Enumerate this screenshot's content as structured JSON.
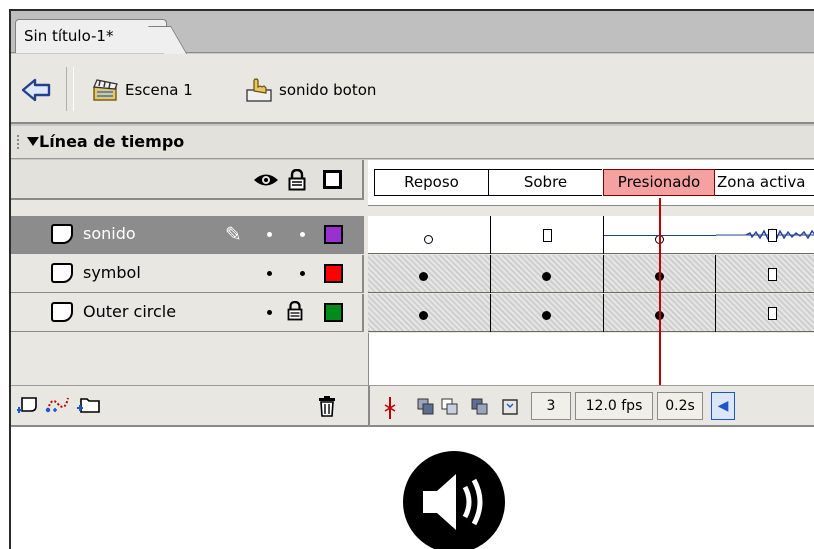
{
  "document": {
    "tab_title": "Sin título-1*"
  },
  "breadcrumb": {
    "scene_label": "Escena 1",
    "symbol_label": "sonido boton"
  },
  "timeline": {
    "panel_title": "Línea de tiempo",
    "frame_labels": [
      "Reposo",
      "Sobre",
      "Presionado",
      "Zona activa"
    ],
    "current_frame_label": "Presionado",
    "layers": [
      {
        "name": "sonido",
        "selected": true,
        "color": "#9b30d0",
        "keyframes": [
          "empty",
          "end",
          "playhead",
          "end-with-sound"
        ]
      },
      {
        "name": "symbol",
        "selected": false,
        "color": "#ff0000",
        "keyframes": [
          "filled",
          "filled",
          "filled",
          "end"
        ]
      },
      {
        "name": "Outer circle",
        "selected": false,
        "color": "#008c1a",
        "locked": true,
        "keyframes": [
          "filled",
          "filled",
          "filled",
          "end"
        ]
      }
    ],
    "status": {
      "current_frame": "3",
      "frame_rate": "12.0 fps",
      "elapsed_time": "0.2s"
    }
  },
  "icons": [
    "back-arrow-icon",
    "scene-clapper-icon",
    "button-symbol-icon",
    "eye-icon",
    "lock-icon",
    "outline-icon",
    "pencil-icon",
    "insert-layer-icon",
    "motion-guide-icon",
    "insert-folder-icon",
    "trash-icon",
    "center-frame-icon",
    "onion-skin-icon",
    "onion-outline-icon",
    "edit-multiple-icon",
    "modify-markers-icon",
    "speaker-icon"
  ],
  "colors": {
    "current_frame_highlight": "#f6a1a1",
    "playhead": "#c00000"
  }
}
